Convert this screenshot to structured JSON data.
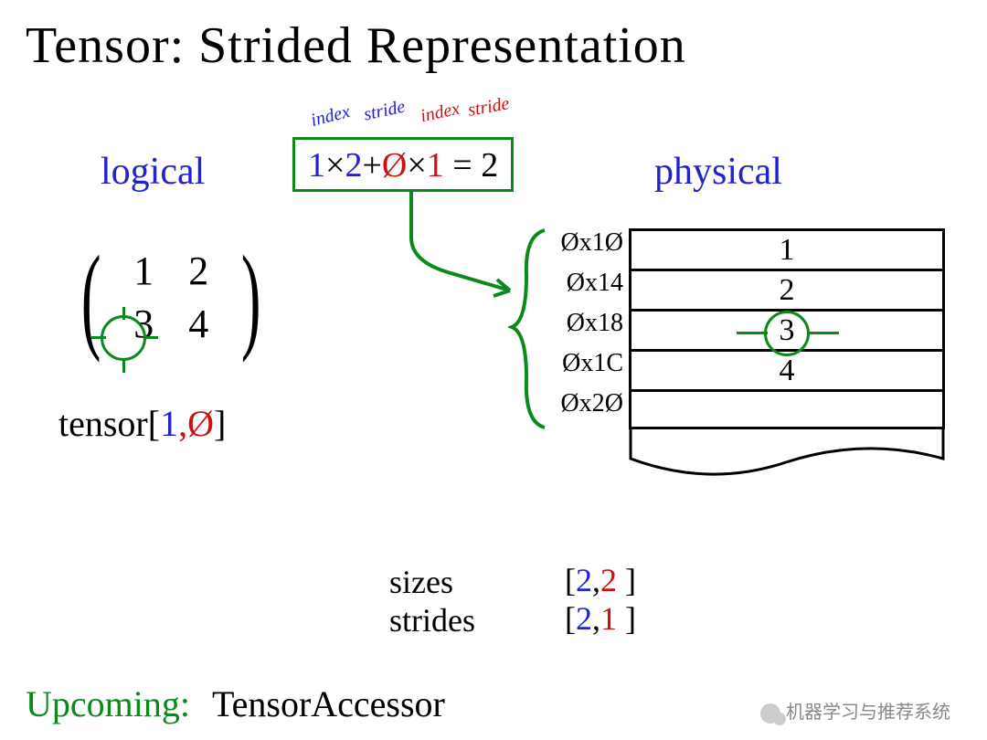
{
  "title": "Tensor: Strided Representation",
  "annotations": {
    "index1": "index",
    "stride1": "stride",
    "index2": "index",
    "stride2": "stride"
  },
  "formula": {
    "t1": "1",
    "t2": "×",
    "t3": "2",
    "t4": "+",
    "t5": "Ø",
    "t6": "×",
    "t7": "1",
    "t8": " = 2"
  },
  "headings": {
    "logical": "logical",
    "physical": "physical"
  },
  "matrix": {
    "cells": [
      "1",
      "2",
      "3",
      "4"
    ]
  },
  "tensor_index": {
    "prefix": "tensor[",
    "a": "1",
    "comma": ",",
    "b": "Ø",
    "suffix": "]"
  },
  "memory": {
    "addresses": [
      "Øx1Ø",
      "Øx14",
      "Øx18",
      "Øx1C",
      "Øx2Ø"
    ],
    "values": [
      "1",
      "2",
      "3",
      "4"
    ],
    "highlighted_index": 2
  },
  "meta": {
    "sizes_label": "sizes",
    "strides_label": "strides",
    "sizes_a": "2",
    "sizes_b": "2",
    "strides_a": "2",
    "strides_b": "1"
  },
  "footer": {
    "label": "Upcoming:",
    "value": "TensorAccessor"
  },
  "watermark": "机器学习与推荐系统",
  "colors": {
    "blue": "#2222d0",
    "red": "#d01010",
    "green": "#0a8a1a"
  }
}
